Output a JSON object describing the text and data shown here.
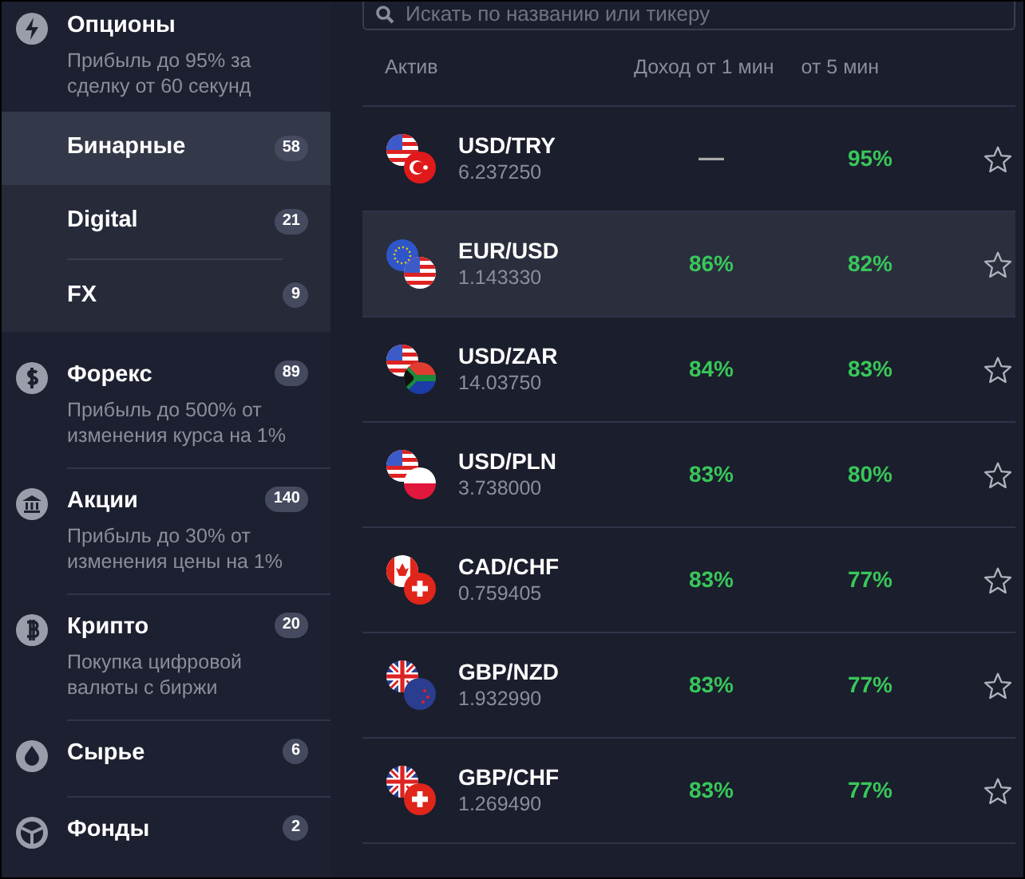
{
  "sidebar": {
    "sections": [
      {
        "title": "Опционы",
        "subtitle": "Прибыль до 95% за сделку от 60 секунд",
        "children": [
          {
            "label": "Бинарные",
            "count": "58",
            "selected": true
          },
          {
            "label": "Digital",
            "count": "21",
            "selected": false
          },
          {
            "label": "FX",
            "count": "9",
            "selected": false
          }
        ]
      },
      {
        "title": "Форекс",
        "count": "89",
        "subtitle": "Прибыль до 500% от изменения курса на 1%"
      },
      {
        "title": "Акции",
        "count": "140",
        "subtitle": "Прибыль до 30% от изменения цены на 1%"
      },
      {
        "title": "Крипто",
        "count": "20",
        "subtitle": "Покупка цифровой валюты с биржи"
      },
      {
        "title": "Сырье",
        "count": "6"
      },
      {
        "title": "Фонды",
        "count": "2"
      }
    ]
  },
  "search": {
    "placeholder": "Искать по названию или тикеру"
  },
  "table": {
    "columns": [
      "Актив",
      "Доход от 1 мин",
      "от 5 мин"
    ],
    "rows": [
      {
        "name": "USD/TRY",
        "price": "6.237250",
        "min1": "—",
        "min5": "95%",
        "selected": false
      },
      {
        "name": "EUR/USD",
        "price": "1.143330",
        "min1": "86%",
        "min5": "82%",
        "selected": true
      },
      {
        "name": "USD/ZAR",
        "price": "14.03750",
        "min1": "84%",
        "min5": "83%",
        "selected": false
      },
      {
        "name": "USD/PLN",
        "price": "3.738000",
        "min1": "83%",
        "min5": "80%",
        "selected": false
      },
      {
        "name": "CAD/CHF",
        "price": "0.759405",
        "min1": "83%",
        "min5": "77%",
        "selected": false
      },
      {
        "name": "GBP/NZD",
        "price": "1.932990",
        "min1": "83%",
        "min5": "77%",
        "selected": false
      },
      {
        "name": "GBP/CHF",
        "price": "1.269490",
        "min1": "83%",
        "min5": "77%",
        "selected": false
      }
    ]
  }
}
